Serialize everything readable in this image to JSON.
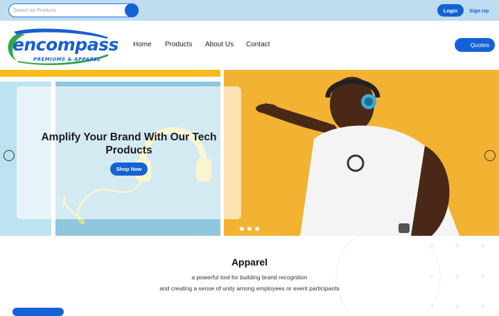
{
  "topbar": {
    "search_placeholder": "Search for Products",
    "login_label": "Login",
    "signup_label": "Sign Up"
  },
  "header": {
    "logo_word": "encompass",
    "logo_tagline": "PREMIUMS & APPAREL",
    "nav": [
      "Home",
      "Products",
      "About Us",
      "Contact"
    ],
    "quotes_label": "Quotes"
  },
  "hero": {
    "title": "Amplify Your Brand With Our Tech Products",
    "cta_label": "Shop Now",
    "slide_count": 3,
    "active_slide": 1
  },
  "section": {
    "title": "Apparel",
    "line1": "a powerful tool for building brand recognition",
    "line2": "and creating a sense of unity among employees or event participants"
  },
  "colors": {
    "brand_blue": "#1463d6",
    "logo_green": "#2fa84a",
    "topbar_bg": "#bfdcf0",
    "hero_yellow": "#f2b332",
    "hero_sky": "#8fc7df"
  },
  "icons": [
    "search-icon",
    "arrow-left-icon",
    "arrow-right-icon",
    "user-icon"
  ]
}
